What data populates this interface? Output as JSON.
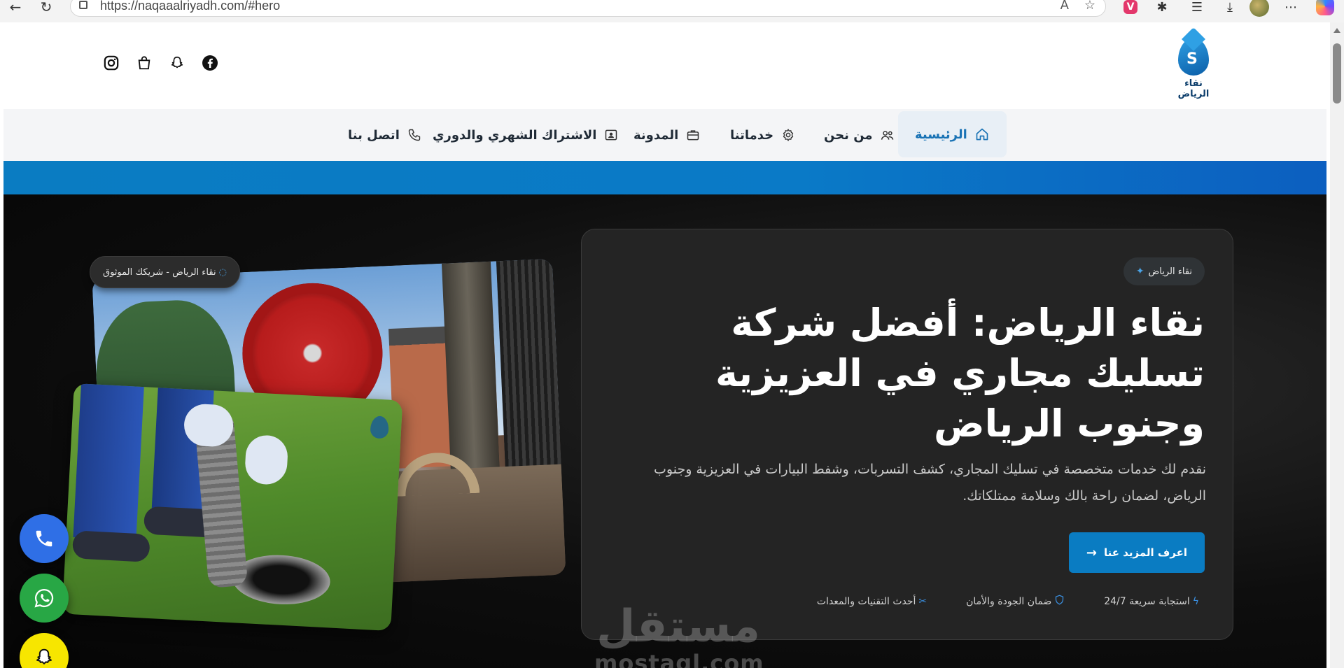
{
  "browser": {
    "url": "https://naqaaalriyadh.com/#hero"
  },
  "header": {
    "logo_text": "نقاء الرياض",
    "social_icons": [
      "instagram-icon",
      "shopping-bag-icon",
      "snapchat-icon",
      "facebook-icon"
    ]
  },
  "nav": {
    "items": [
      {
        "label": "الرئيسية",
        "icon": "home-icon",
        "active": true
      },
      {
        "label": "من نحن",
        "icon": "users-icon",
        "active": false
      },
      {
        "label": "خدماتنا",
        "icon": "gear-icon",
        "active": false
      },
      {
        "label": "المدونة",
        "icon": "briefcase-icon",
        "active": false
      },
      {
        "label": "الاشتراك الشهري والدوري",
        "icon": "id-card-icon",
        "active": false
      },
      {
        "label": "اتصل بنا",
        "icon": "phone-icon",
        "active": false
      }
    ]
  },
  "hero": {
    "badge": "نقاء الرياض",
    "title_line1": "نقاء الرياض: أفضل شركة",
    "title_line2": "تسليك مجاري في العزيزية",
    "title_line3": "وجنوب الرياض",
    "description": "نقدم لك خدمات متخصصة في تسليك المجاري، كشف التسربات، وشفط البيارات في العزيزية وجنوب الرياض، لضمان راحة بالك وسلامة ممتلكاتك.",
    "cta_label": "اعرف المزيد عنا",
    "features": [
      {
        "label": "استجابة سريعة 24/7",
        "icon": "lightning-icon"
      },
      {
        "label": "ضمان الجودة والأمان",
        "icon": "shield-icon"
      },
      {
        "label": "أحدث التقنيات والمعدات",
        "icon": "tools-icon"
      }
    ],
    "image_pill": "نقاء الرياض - شريكك الموثوق"
  },
  "watermark": {
    "arabic": "مستقل",
    "latin": "mostaql.com"
  },
  "colors": {
    "brand_blue": "#0a7cc2",
    "hero_bg": "#0e0e0e",
    "card_bg": "#242424"
  }
}
